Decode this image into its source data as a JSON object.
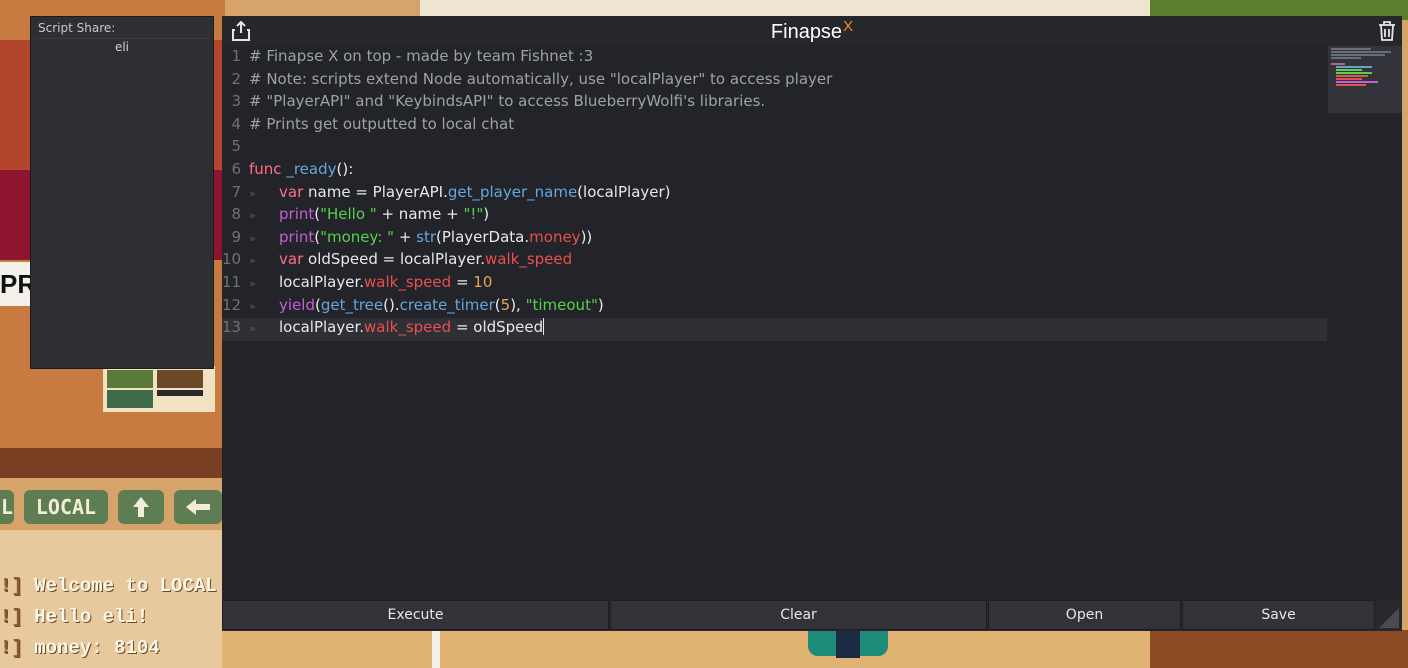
{
  "app": {
    "title": "Finapse",
    "title_sup": "X",
    "accent": "#f28a2c"
  },
  "script_share": {
    "title": "Script Share:",
    "items": [
      "eli"
    ]
  },
  "editor": {
    "lines": [
      {
        "n": "1",
        "tokens": [
          {
            "t": "# Finapse X on top - made by team Fishnet :3",
            "c": "com"
          }
        ]
      },
      {
        "n": "2",
        "tokens": [
          {
            "t": "# Note: scripts extend Node automatically, use \"localPlayer\" to access player",
            "c": "com"
          }
        ]
      },
      {
        "n": "3",
        "tokens": [
          {
            "t": "# \"PlayerAPI\" and \"KeybindsAPI\" to access BlueberryWolfi's libraries.",
            "c": "com"
          }
        ]
      },
      {
        "n": "4",
        "tokens": [
          {
            "t": "# Prints get outputted to local chat",
            "c": "com"
          }
        ]
      },
      {
        "n": "5",
        "tokens": []
      },
      {
        "n": "6",
        "tokens": [
          {
            "t": "func",
            "c": "kw"
          },
          {
            "t": " ",
            "c": "plain"
          },
          {
            "t": "_ready",
            "c": "fn"
          },
          {
            "t": "():",
            "c": "plain"
          }
        ]
      },
      {
        "n": "7",
        "indent": 1,
        "tokens": [
          {
            "t": "var",
            "c": "kw"
          },
          {
            "t": " name = PlayerAPI.",
            "c": "plain"
          },
          {
            "t": "get_player_name",
            "c": "fn"
          },
          {
            "t": "(localPlayer)",
            "c": "plain"
          }
        ]
      },
      {
        "n": "8",
        "indent": 1,
        "tokens": [
          {
            "t": "print",
            "c": "kw2"
          },
          {
            "t": "(",
            "c": "plain"
          },
          {
            "t": "\"Hello \"",
            "c": "str"
          },
          {
            "t": " + name + ",
            "c": "plain"
          },
          {
            "t": "\"!\"",
            "c": "str"
          },
          {
            "t": ")",
            "c": "plain"
          }
        ]
      },
      {
        "n": "9",
        "indent": 1,
        "tokens": [
          {
            "t": "print",
            "c": "kw2"
          },
          {
            "t": "(",
            "c": "plain"
          },
          {
            "t": "\"money: \"",
            "c": "str"
          },
          {
            "t": " + ",
            "c": "plain"
          },
          {
            "t": "str",
            "c": "fn"
          },
          {
            "t": "(PlayerData.",
            "c": "plain"
          },
          {
            "t": "money",
            "c": "prop"
          },
          {
            "t": "))",
            "c": "plain"
          }
        ]
      },
      {
        "n": "10",
        "indent": 1,
        "tokens": [
          {
            "t": "var",
            "c": "kw"
          },
          {
            "t": " oldSpeed = localPlayer.",
            "c": "plain"
          },
          {
            "t": "walk_speed",
            "c": "prop"
          }
        ]
      },
      {
        "n": "11",
        "indent": 1,
        "tokens": [
          {
            "t": "localPlayer.",
            "c": "plain"
          },
          {
            "t": "walk_speed",
            "c": "prop"
          },
          {
            "t": " = ",
            "c": "plain"
          },
          {
            "t": "10",
            "c": "num"
          }
        ]
      },
      {
        "n": "12",
        "indent": 1,
        "tokens": [
          {
            "t": "yield",
            "c": "kw2"
          },
          {
            "t": "(",
            "c": "plain"
          },
          {
            "t": "get_tree",
            "c": "fn"
          },
          {
            "t": "().",
            "c": "plain"
          },
          {
            "t": "create_timer",
            "c": "fn"
          },
          {
            "t": "(",
            "c": "plain"
          },
          {
            "t": "5",
            "c": "num"
          },
          {
            "t": "), ",
            "c": "plain"
          },
          {
            "t": "\"timeout\"",
            "c": "str"
          },
          {
            "t": ")",
            "c": "plain"
          }
        ]
      },
      {
        "n": "13",
        "indent": 1,
        "current": true,
        "tokens": [
          {
            "t": "localPlayer.",
            "c": "plain"
          },
          {
            "t": "walk_speed",
            "c": "prop"
          },
          {
            "t": " = oldSpeed",
            "c": "plain"
          }
        ]
      }
    ],
    "tab_glyph": "»"
  },
  "buttons": {
    "execute": "Execute",
    "clear": "Clear",
    "open": "Open",
    "save": "Save"
  },
  "game": {
    "sign_text": "PRI",
    "chat_tab_left": "L",
    "chat_tab_local": "LOCAL",
    "chat_lines": [
      {
        "prefix": "!]",
        "text": "Welcome to LOCAL c"
      },
      {
        "prefix": "!]",
        "text": "Hello eli!"
      },
      {
        "prefix": "!]",
        "text": "money: 8104"
      }
    ]
  }
}
